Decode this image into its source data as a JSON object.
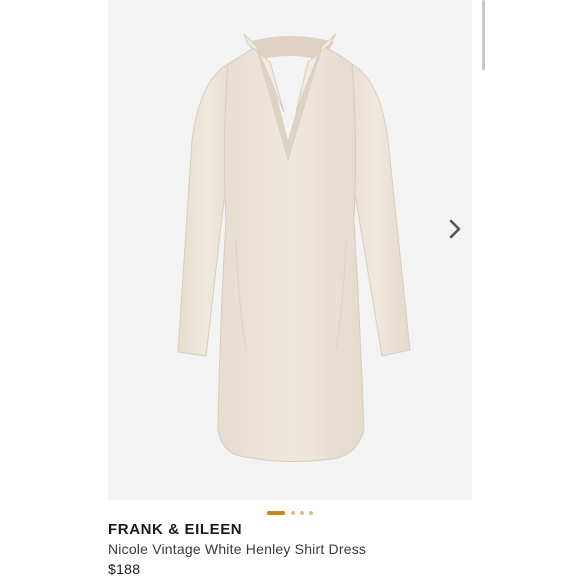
{
  "product": {
    "brand": "FRANK & EILEEN",
    "name": "Nicole Vintage White Henley Shirt Dress",
    "price": "$188",
    "image_subject": "dress-image"
  },
  "carousel": {
    "active_index": 1,
    "total": 4,
    "next_icon": "chevron-right-icon"
  },
  "colors": {
    "image_background": "#f3f3f3",
    "dress_fabric": "#ede5da",
    "active_dot": "#c8851d",
    "inactive_dot": "#e2b97a"
  }
}
